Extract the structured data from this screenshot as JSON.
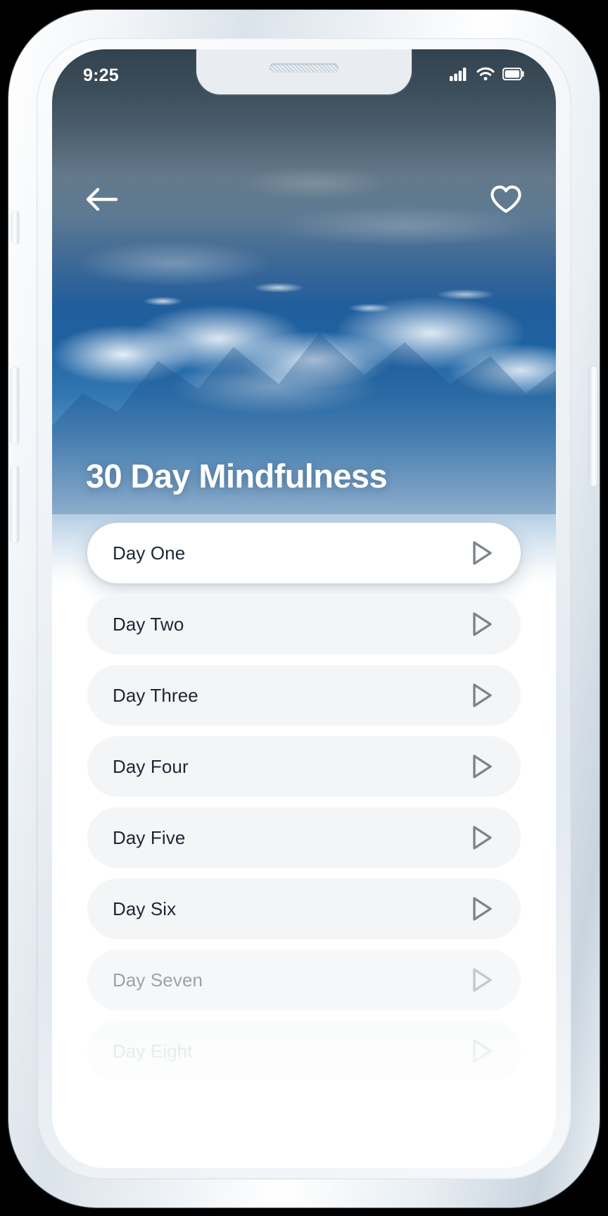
{
  "status_bar": {
    "time": "9:25",
    "icons": [
      "cellular-signal-icon",
      "wifi-icon",
      "battery-icon"
    ]
  },
  "top_nav": {
    "back_icon": "arrow-left-icon",
    "favorite_icon": "heart-outline-icon"
  },
  "header": {
    "title": "30 Day Mindfulness",
    "background": "mountain-clouds-photo"
  },
  "colors": {
    "sky_blue": "#1e62a2",
    "slate": "#40505c",
    "card_active": "#ffffff",
    "card_normal": "#f4f5f7",
    "text_primary": "#1d2733",
    "text_dim": "#9aa3ad",
    "play_icon": "#7c848d"
  },
  "day_list": {
    "play_icon": "play-triangle-icon",
    "items": [
      {
        "label": "Day One",
        "state": "active"
      },
      {
        "label": "Day Two",
        "state": "normal"
      },
      {
        "label": "Day Three",
        "state": "normal"
      },
      {
        "label": "Day Four",
        "state": "normal"
      },
      {
        "label": "Day Five",
        "state": "normal"
      },
      {
        "label": "Day Six",
        "state": "normal"
      },
      {
        "label": "Day Seven",
        "state": "dim"
      },
      {
        "label": "Day Eight",
        "state": "faded"
      }
    ]
  },
  "device": {
    "buttons": [
      "silent-switch",
      "volume-up-button",
      "volume-down-button",
      "power-button"
    ]
  }
}
